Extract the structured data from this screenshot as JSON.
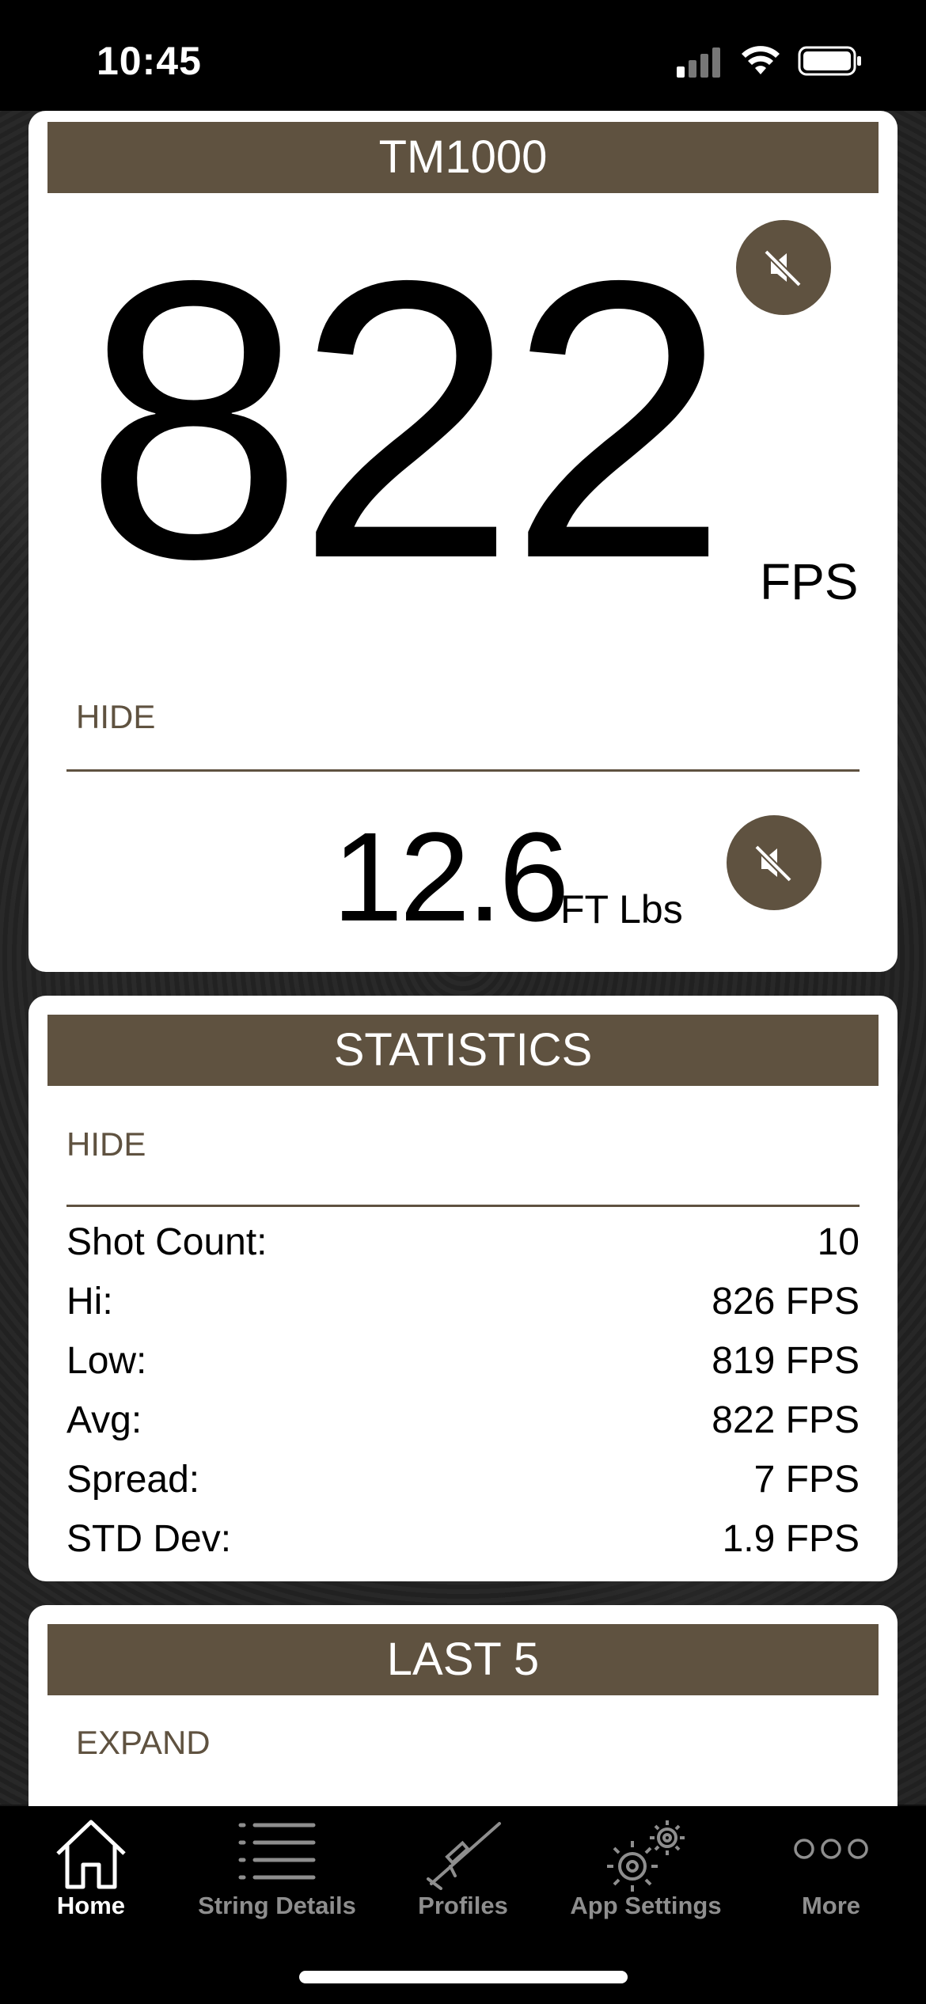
{
  "status_bar": {
    "time": "10:45"
  },
  "velocity_card": {
    "device_name": "TM1000",
    "velocity_value": "822",
    "velocity_unit": "FPS",
    "hide_label": "HIDE",
    "energy_value": "12.6",
    "energy_unit": "FT Lbs"
  },
  "statistics_card": {
    "title": "STATISTICS",
    "hide_label": "HIDE",
    "rows": [
      {
        "label": "Shot Count:",
        "value": "10"
      },
      {
        "label": "Hi:",
        "value": "826 FPS"
      },
      {
        "label": "Low:",
        "value": "819 FPS"
      },
      {
        "label": "Avg:",
        "value": "822 FPS"
      },
      {
        "label": "Spread:",
        "value": "7 FPS"
      },
      {
        "label": "STD Dev:",
        "value": "1.9 FPS"
      }
    ]
  },
  "last5_card": {
    "title": "LAST 5",
    "expand_label": "EXPAND"
  },
  "tab_bar": {
    "tabs": [
      {
        "label": "Home",
        "icon": "home-icon",
        "active": true
      },
      {
        "label": "String Details",
        "icon": "list-icon",
        "active": false
      },
      {
        "label": "Profiles",
        "icon": "rifle-icon",
        "active": false
      },
      {
        "label": "App Settings",
        "icon": "gears-icon",
        "active": false
      },
      {
        "label": "More",
        "icon": "more-icon",
        "active": false
      }
    ]
  },
  "colors": {
    "accent": "#5f5240",
    "card": "#ffffff",
    "tab_active": "#ffffff",
    "tab_inactive": "#8e8e8e"
  }
}
